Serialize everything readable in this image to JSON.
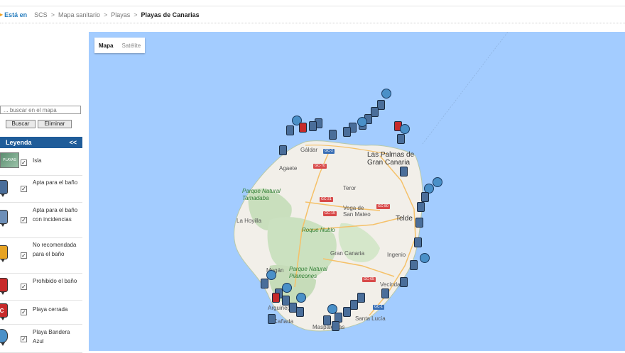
{
  "breadcrumb": {
    "here_label": "Está en",
    "items": [
      "SCS",
      "Mapa sanitario",
      "Playas"
    ],
    "separator": ">",
    "current": "Playas de Canarias"
  },
  "sidebar": {
    "search_placeholder": "... buscar en el mapa",
    "search_button": "Buscar",
    "delete_button": "Eliminar",
    "legend_title": "Leyenda",
    "legend_toggle": "<<",
    "legend_items": [
      {
        "label": "Isla",
        "icon": "island-thumbnail-icon",
        "badge": "PLAYAS"
      },
      {
        "label": "Apta para el baño",
        "icon": "fit-for-bathing-icon",
        "badge": ""
      },
      {
        "label": "Apta para el baño con incidencias",
        "icon": "fit-with-incidents-icon",
        "badge": ""
      },
      {
        "label": "No recomendada para el baño",
        "icon": "not-recommended-icon",
        "badge": ""
      },
      {
        "label": "Prohibido el baño",
        "icon": "bathing-prohibited-icon",
        "badge": ""
      },
      {
        "label": "Playa cerrada",
        "icon": "beach-closed-icon",
        "badge": "C"
      },
      {
        "label": "Playa Bandera Azul",
        "icon": "blue-flag-icon",
        "badge": ""
      }
    ]
  },
  "map": {
    "type_buttons": [
      "Mapa",
      "Satélite"
    ],
    "active_type": "Mapa",
    "place_labels": [
      "Gáldar",
      "Agaete",
      "Las Palmas de Gran Canaria",
      "Parque Natural Tamadaba",
      "Teror",
      "Vega de San Mateo",
      "La Hoyilla",
      "Roque Nublo",
      "Telde",
      "Ingenio",
      "Gran Canaria",
      "Parque Natural Pilancones",
      "Mogán",
      "Vecindario",
      "Maspalomas",
      "Santa Lucía",
      "Arguineguín",
      "Cañada"
    ],
    "road_badges": [
      "GC-2",
      "GC-70",
      "GC-21",
      "GC-15",
      "GC-80",
      "GC-65",
      "GC-1"
    ],
    "colors": {
      "water": "#a3ccff",
      "land": "#f2efe9",
      "marker_default": "#4a6e9a",
      "marker_red": "#c72a2a",
      "legend_header": "#1f5c99"
    }
  }
}
